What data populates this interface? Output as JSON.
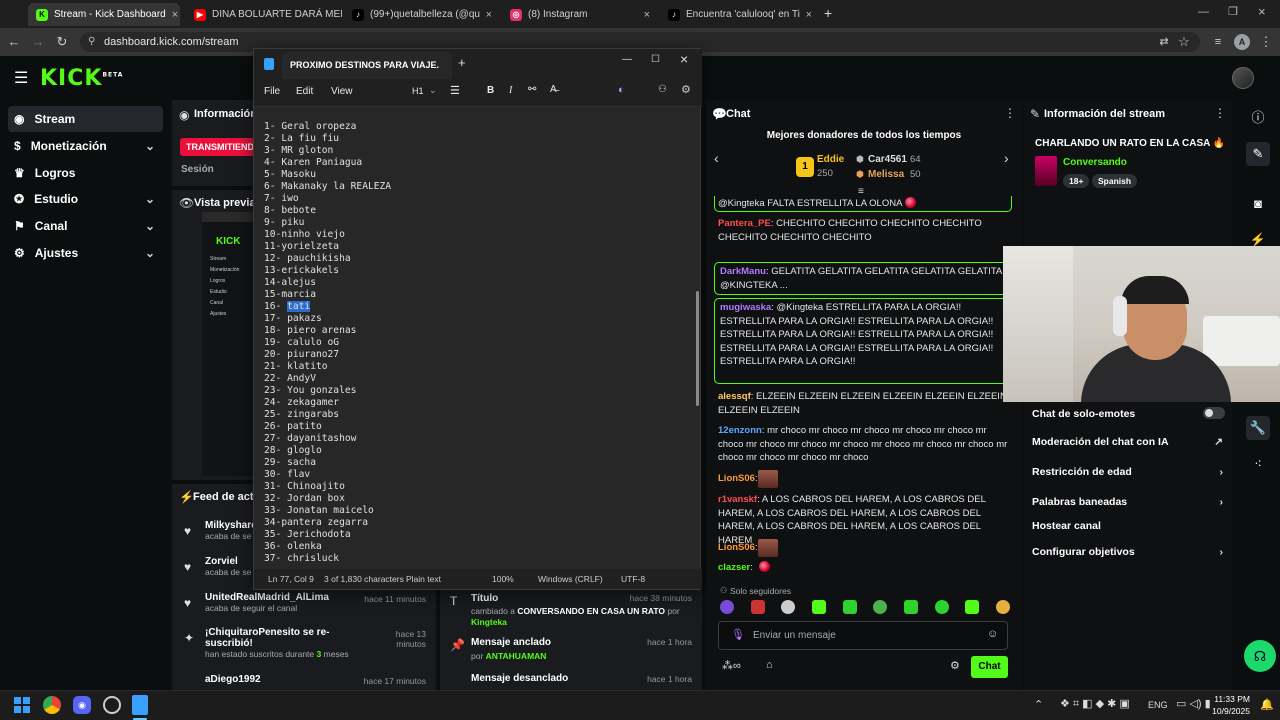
{
  "browser": {
    "tabs": [
      {
        "title": "Stream - Kick Dashboard",
        "icon": "kick-icon",
        "color": "#53fc18"
      },
      {
        "title": "DINA BOLUARTE DARÁ MENSAJE",
        "icon": "youtube-icon",
        "color": "#ff0000"
      },
      {
        "title": "(99+)quetalbelleza (@quetalbe",
        "icon": "tiktok-icon",
        "color": "#ffffff"
      },
      {
        "title": "(8) Instagram",
        "icon": "instagram-icon",
        "color": "#e1306c"
      },
      {
        "title": "Encuentra 'calulooq' en TikTok",
        "icon": "tiktok-icon",
        "color": "#ffffff"
      }
    ],
    "url": "dashboard.kick.com/stream",
    "profile_initial": "A"
  },
  "kick": {
    "logo": "KICK",
    "logo_badge": "BETA",
    "accent": "#53fc18"
  },
  "sidebar": {
    "items": [
      {
        "label": "Stream",
        "icon": "broadcast-icon",
        "has_chevron": false
      },
      {
        "label": "Monetización",
        "icon": "dollar-icon",
        "has_chevron": true
      },
      {
        "label": "Logros",
        "icon": "trophy-icon",
        "has_chevron": false
      },
      {
        "label": "Estudio",
        "icon": "studio-icon",
        "has_chevron": true
      },
      {
        "label": "Canal",
        "icon": "flag-icon",
        "has_chevron": true
      },
      {
        "label": "Ajustes",
        "icon": "gear-icon",
        "has_chevron": true
      }
    ]
  },
  "stream_panel": {
    "info_title": "Información",
    "live_badge": "TRANSMITIENDO",
    "session_label": "Sesión",
    "preview_title": "Vista previa d",
    "preview_logo": "KICK",
    "preview_menu": [
      "Stream",
      "Monetización",
      "Logros",
      "Estudio",
      "Canal",
      "Ajustes"
    ]
  },
  "feed": {
    "title": "Feed de activ",
    "items": [
      {
        "name": "Milkyshare",
        "sub": "acaba de se",
        "time": ""
      },
      {
        "name": "Zorviel",
        "sub": "acaba de se",
        "time": ""
      },
      {
        "name": "UnitedRealMadrid_AlLima",
        "sub": "acaba de seguir el canal",
        "time": "hace 11 minutos"
      },
      {
        "name": "¡ChiquitaroPenesito se re-suscribió!",
        "sub": "han estado suscritos durante",
        "sub_strong": "3",
        "sub_end": "meses",
        "time": "hace 13 minutos"
      },
      {
        "name": "aDiego1992",
        "sub": "",
        "time": "hace 17 minutos"
      }
    ]
  },
  "events": {
    "items": [
      {
        "title": "Título",
        "line1": "cambiado a",
        "strong": "CONVERSANDO EN CASA UN RATO",
        "line2": "por",
        "user": "Kingteka",
        "time": "hace 38 minutos",
        "icon": "title-icon"
      },
      {
        "title": "Mensaje anclado",
        "line1": "por",
        "user": "ANTAHUAMAN",
        "time": "hace 1 hora",
        "icon": "pin-icon"
      },
      {
        "title": "Mensaje desanclado",
        "line1": "",
        "user": "",
        "time": "hace 1 hora",
        "icon": "unpin-icon"
      }
    ]
  },
  "notepad": {
    "title": "PROXIMO DESTINOS PARA VIAJE.",
    "menu": [
      "File",
      "Edit",
      "View"
    ],
    "heading_btn": "H1",
    "lines": [
      "1- Geral oropeza",
      "2- La fiu fiu",
      "3- MR gloton",
      "4- Karen Paniagua",
      "5- Masoku",
      "6- Makanaky la REALEZA",
      "7- iwo",
      "8- bebote",
      "9- piku",
      "10-ninho viejo",
      "11-yorielzeta",
      "12- pauchikisha",
      "13-erickakels",
      "14-alejus",
      "15-marcia",
      "16- tati",
      "17- pakazs",
      "18- piero arenas",
      "19- calulo oG",
      "20- piurano27",
      "21- klatito",
      "22- AndyV",
      "23- You gonzales",
      "24- zekagamer",
      "25- zingarabs",
      "26- patito",
      "27- dayanitashow",
      "28- gloglo",
      "29- sacha",
      "30- flav",
      "31- Chinoajito",
      "32- Jordan box",
      "33- Jonatan maicelo",
      "34-pantera zegarra",
      "35- Jerichodota",
      "36- olenka",
      "37- chrisluck"
    ],
    "status": {
      "position": "Ln 77, Col 9",
      "chars": "3 of 1,830 characters",
      "format": "Plain text",
      "zoom": "100%",
      "eol": "Windows (CRLF)",
      "encoding": "UTF-8"
    }
  },
  "chat": {
    "title": "Chat",
    "donors_title": "Mejores donadores de todos los tiempos",
    "donors": [
      {
        "rank": "1",
        "name": "Eddie",
        "amount": "250"
      },
      {
        "name": "Car4561",
        "amount": "64"
      },
      {
        "name": "Melissa",
        "amount": "50"
      }
    ],
    "pinned_partial": "@Kingteka FALTA ESTRELLITA LA OLONA",
    "messages": [
      {
        "user": "Pantera_PE",
        "color": "#ff4d4d",
        "text": "CHECHITO CHECHITO CHECHITO CHECHITO CHECHITO CHECHITO CHECHITO"
      },
      {
        "user": "DarkManu",
        "color": "#b57aff",
        "text": "GELATITA GELATITA GELATITA GELATITA GELATITA @KINGTEKA ..."
      },
      {
        "user": "mugiwaska",
        "color": "#b57aff",
        "text": "@Kingteka ESTRELLITA PARA LA ORGIA!! ESTRELLITA PARA LA ORGIA!! ESTRELLITA PARA LA ORGIA!! ESTRELLITA PARA LA ORGIA!! ESTRELLITA PARA LA ORGIA!! ESTRELLITA PARA LA ORGIA!! ESTRELLITA PARA LA ORGIA!! ESTRELLITA PARA LA ORGIA!!"
      },
      {
        "user": "alessqf",
        "color": "#ffcc66",
        "text": "ELZEEIN ELZEEIN ELZEEIN ELZEEIN ELZEEIN ELZEEIN ELZEEIN ELZEEIN"
      },
      {
        "user": "12enzonn",
        "color": "#5aa9ff",
        "text": "mr choco mr choco mr choco mr choco mr choco mr choco mr choco mr choco mr choco mr choco mr choco mr choco mr choco mr choco mr choco mr choco"
      },
      {
        "user": "LionS06",
        "color": "#ff9a3c",
        "text": ""
      },
      {
        "user": "r1vanskf",
        "color": "#ff4d4d",
        "text": "A LOS CABROS DEL HAREM, A LOS CABROS DEL HAREM, A LOS CABROS DEL HAREM, A LOS CABROS DEL HAREM, A LOS CABROS DEL HAREM, A LOS CABROS DEL HAREM"
      },
      {
        "user": "LionS06",
        "color": "#ff9a3c",
        "text": ""
      },
      {
        "user": "clazser",
        "color": "#53fc18",
        "text": ""
      }
    ],
    "followers_only": "Solo seguidores",
    "input_placeholder": "Enviar un mensaje",
    "send_label": "Chat"
  },
  "info_panel": {
    "title": "Información del stream",
    "stream_title": "CHARLANDO UN RATO EN LA CASA",
    "category": "Conversando",
    "tags": [
      "18+",
      "Spanish"
    ],
    "settings": [
      {
        "label": "Chat de solo-emotes",
        "control": "toggle"
      },
      {
        "label": "Moderación del chat con IA",
        "control": "external"
      },
      {
        "label": "Restricción de edad",
        "control": "chevron"
      },
      {
        "label": "Palabras baneadas",
        "control": "chevron"
      },
      {
        "label": "Hostear canal",
        "control": "none"
      },
      {
        "label": "Configurar objetivos",
        "control": "chevron"
      }
    ]
  },
  "taskbar": {
    "language": "ENG",
    "time": "11:33 PM",
    "date": "10/9/2025"
  }
}
